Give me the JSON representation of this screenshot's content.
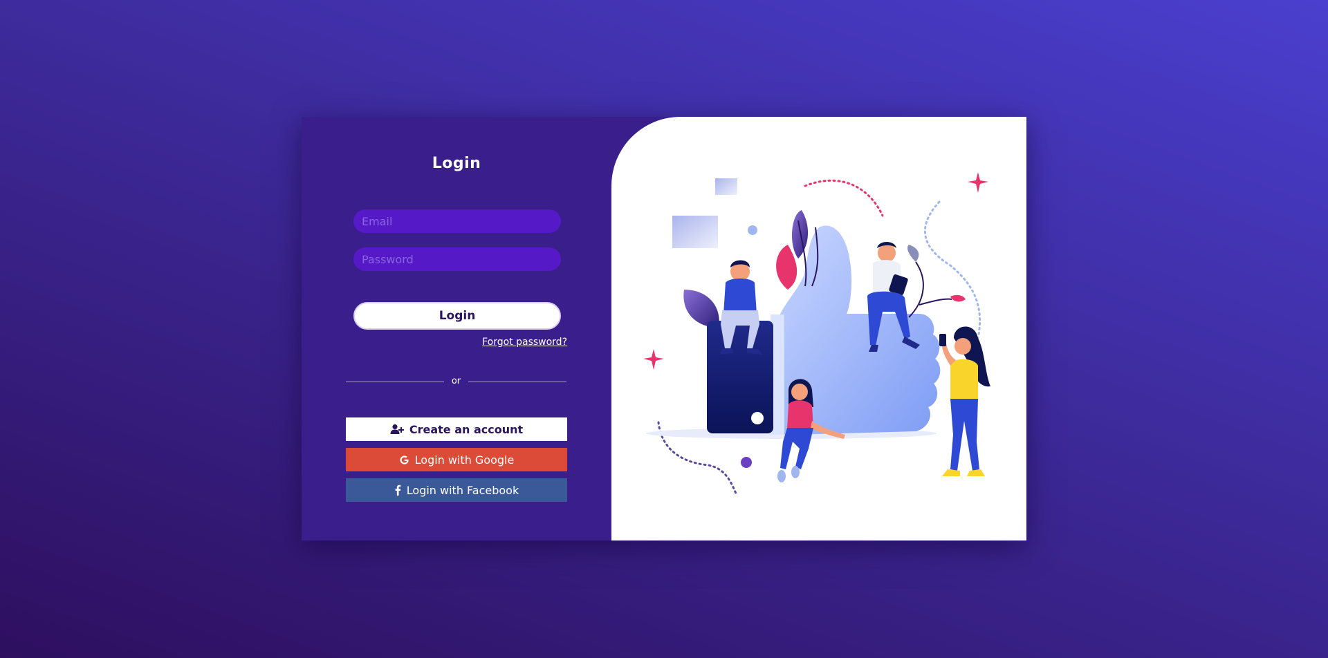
{
  "login_form": {
    "title": "Login",
    "email_placeholder": "Email",
    "password_placeholder": "Password",
    "login_button_label": "Login",
    "forgot_password_label": "Forgot password?",
    "divider_text": "or"
  },
  "social": {
    "create_account_label": "Create an account",
    "create_account_icon": "user-plus-icon",
    "google_label": "Login with Google",
    "google_icon": "google-icon",
    "facebook_label": "Login with Facebook",
    "facebook_icon": "facebook-icon"
  },
  "colors": {
    "page_background": "#3d2a9a",
    "card_left_background": "#3a1e8c",
    "input_background": "#5519c8",
    "google": "#dc4a38",
    "facebook": "#3b5998",
    "accent_pink": "#e8346c"
  },
  "illustration": {
    "description_icon": "thumbs-up-people-illustration"
  }
}
